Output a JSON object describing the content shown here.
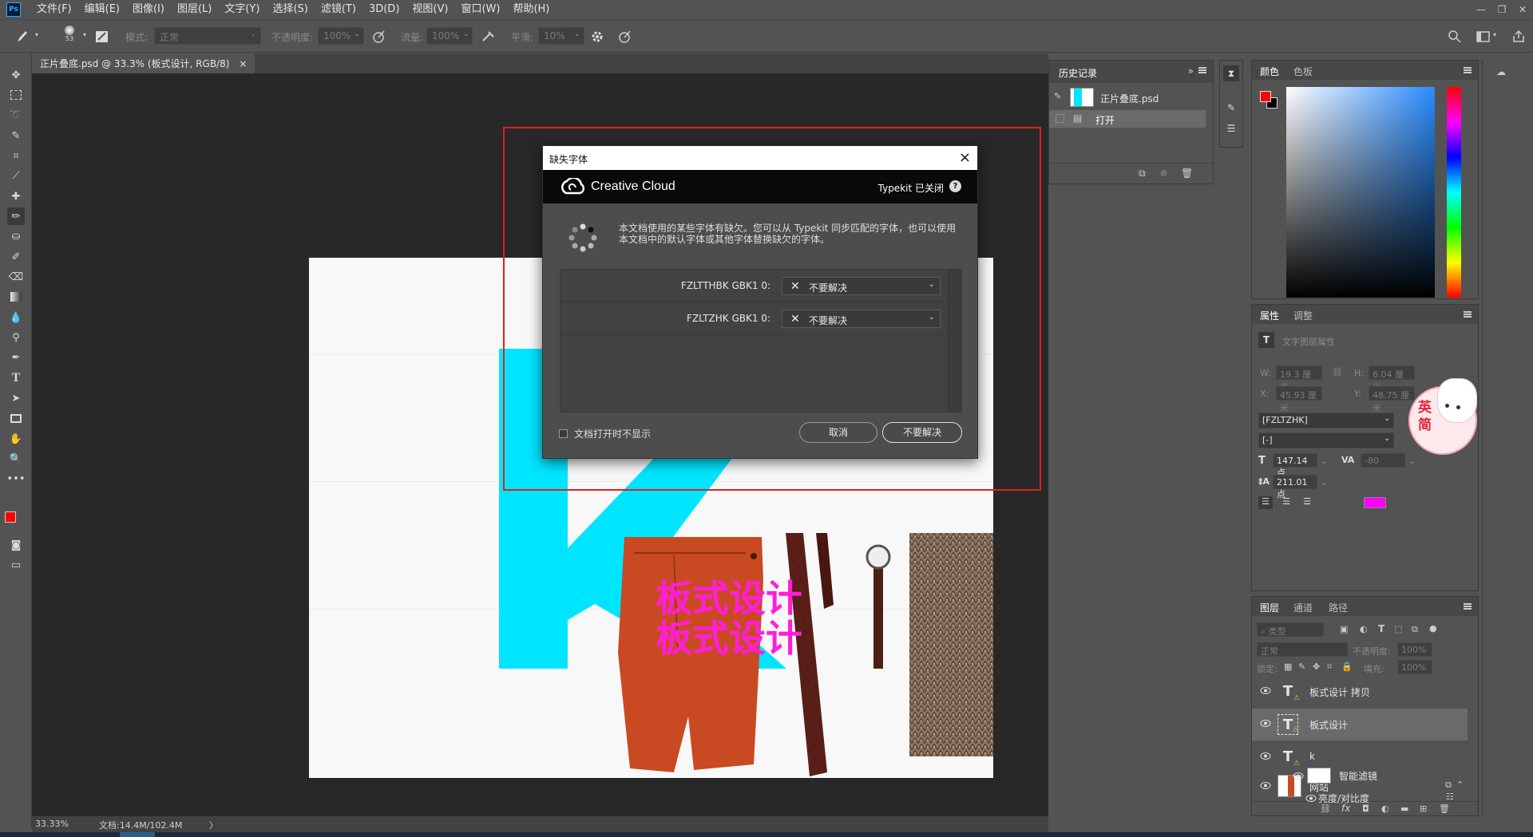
{
  "menu": {
    "logo": "Ps",
    "items": [
      "文件(F)",
      "编辑(E)",
      "图像(I)",
      "图层(L)",
      "文字(Y)",
      "选择(S)",
      "滤镜(T)",
      "3D(D)",
      "视图(V)",
      "窗口(W)",
      "帮助(H)"
    ]
  },
  "options": {
    "brush_size": "53",
    "mode_label": "模式:",
    "mode_value": "正常",
    "opacity_label": "不透明度:",
    "opacity_value": "100%",
    "flow_label": "流量:",
    "flow_value": "100%",
    "smooth_label": "平滑:",
    "smooth_value": "10%"
  },
  "document": {
    "tab_title": "正片叠底.psd @ 33.3% (板式设计, RGB/8)",
    "close": "×"
  },
  "canvas_text": {
    "line1": "板式设计",
    "line2": "板式设计"
  },
  "status": {
    "zoom": "33.33%",
    "doc_size": "文档:14.4M/102.4M",
    "arrow": "〉"
  },
  "dialog": {
    "title": "缺失字体",
    "brand": "Creative Cloud",
    "typekit_status": "Typekit 已关闭",
    "help": "?",
    "message": "本文档使用的某些字体有缺欠。您可以从 Typekit 同步匹配的字体，也可以使用本文档中的默认字体或其他字体替换缺欠的字体。",
    "fonts": [
      {
        "name": "FZLTTHBK  GBK1 0:",
        "action": "不要解决"
      },
      {
        "name": "FZLTZHK  GBK1 0:",
        "action": "不要解决"
      }
    ],
    "dont_show": "文档打开时不显示",
    "cancel": "取消",
    "dont_resolve": "不要解决"
  },
  "history": {
    "tab": "历史记录",
    "snapshot": "正片叠底.psd",
    "items": [
      "打开"
    ]
  },
  "color": {
    "tabs": [
      "颜色",
      "色板"
    ],
    "foreground": "#ff0000",
    "background": "#000000"
  },
  "properties": {
    "tabs": [
      "属性",
      "调整"
    ],
    "section": "文字图层属性",
    "w_label": "W:",
    "w_value": "19.3 厘米",
    "h_label": "H:",
    "h_value": "6.04 厘米",
    "x_label": "X:",
    "x_value": "45.93 厘米",
    "y_label": "Y:",
    "y_value": "48.75 厘米",
    "font_family": "[FZLTZHK]",
    "font_style": "[-]",
    "font_size": "147.14 点",
    "tracking": "-80",
    "leading": "211.01 点",
    "text_color": "#ff00ff"
  },
  "ime": {
    "line1": "英",
    "line2": "简"
  },
  "layers": {
    "tabs": [
      "图层",
      "通道",
      "路径"
    ],
    "filter_label": "类型",
    "blend_mode": "正常",
    "opacity_label": "不透明度:",
    "opacity_value": "100%",
    "lock_label": "锁定:",
    "fill_label": "填充:",
    "fill_value": "100%",
    "items": [
      {
        "name": "板式设计 拷贝",
        "type": "text"
      },
      {
        "name": "板式设计",
        "type": "text"
      },
      {
        "name": "k",
        "type": "text"
      },
      {
        "name": "网站",
        "type": "image"
      }
    ],
    "smart_filter": "智能滤镜",
    "sub_filter": "亮度/对比度"
  }
}
